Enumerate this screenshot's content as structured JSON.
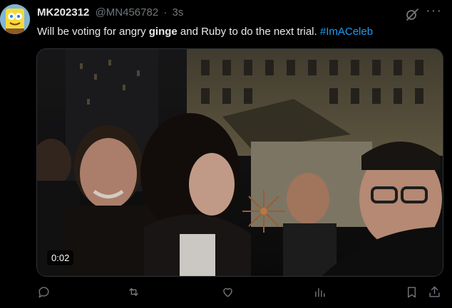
{
  "tweet": {
    "display_name": "MK202312",
    "handle": "@MN456782",
    "separator": "·",
    "time": "3s",
    "text_before": "Will be voting for angry ",
    "text_bold": "ginge",
    "text_after": " and Ruby to do the next trial. ",
    "hashtag": "#ImACeleb",
    "more_label": "···"
  },
  "media": {
    "type": "video",
    "duration": "0:02"
  },
  "actions": [
    "reply-icon",
    "retweet-icon",
    "like-icon",
    "views-icon",
    "bookmark-icon",
    "share-icon"
  ],
  "colors": {
    "background": "#000000",
    "text": "#e7e9ea",
    "muted": "#71767b",
    "link": "#1d9bf0"
  }
}
